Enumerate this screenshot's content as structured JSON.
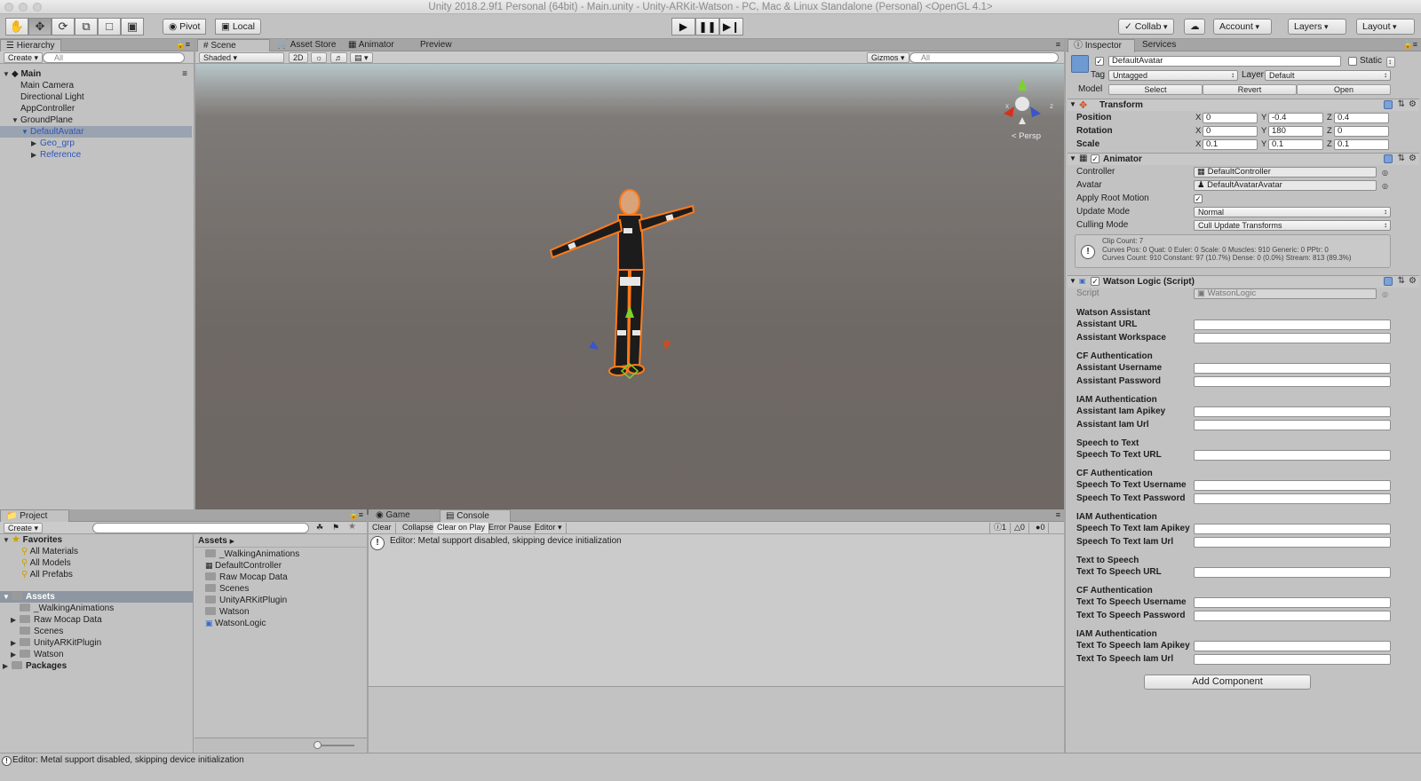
{
  "window": {
    "title": "Unity 2018.2.9f1 Personal (64bit) - Main.unity - Unity-ARKit-Watson - PC, Mac & Linux Standalone (Personal) <OpenGL 4.1>"
  },
  "toolbar": {
    "pivot": "Pivot",
    "local": "Local",
    "collab": "Collab",
    "account": "Account",
    "layers": "Layers",
    "layout": "Layout",
    "tools": [
      "hand-tool-icon",
      "move-tool-icon",
      "rotate-tool-icon",
      "scale-tool-icon",
      "rect-tool-icon",
      "transform-tool-icon"
    ]
  },
  "hierarchy": {
    "tab": "Hierarchy",
    "create": "Create",
    "search_placeholder": "All",
    "scene": "Main",
    "items": [
      {
        "label": "Main Camera"
      },
      {
        "label": "Directional Light"
      },
      {
        "label": "AppController"
      },
      {
        "label": "GroundPlane"
      },
      {
        "label": "DefaultAvatar"
      },
      {
        "label": "Geo_grp"
      },
      {
        "label": "Reference"
      }
    ]
  },
  "scene_view": {
    "tabs": [
      "Scene",
      "Asset Store",
      "Animator",
      "Preview"
    ],
    "shading": "Shaded",
    "mode_2d": "2D",
    "gizmos": "Gizmos",
    "search_placeholder": "All",
    "persp": "Persp",
    "gizmo_x": "x",
    "gizmo_z": "z"
  },
  "project": {
    "tab": "Project",
    "create": "Create",
    "favorites_label": "Favorites",
    "favorites": [
      "All Materials",
      "All Models",
      "All Prefabs"
    ],
    "assets_label": "Assets",
    "asset_tree": [
      "_WalkingAnimations",
      "Raw Mocap Data",
      "Scenes",
      "UnityARKitPlugin",
      "Watson"
    ],
    "packages_label": "Packages",
    "breadcrumb": "Assets",
    "asset_list": [
      "_WalkingAnimations",
      "DefaultController",
      "Raw Mocap Data",
      "Scenes",
      "UnityARKitPlugin",
      "Watson",
      "WatsonLogic"
    ]
  },
  "console": {
    "tabs": [
      "Game",
      "Console"
    ],
    "buttons": [
      "Clear",
      "Collapse",
      "Clear on Play",
      "Error Pause",
      "Editor"
    ],
    "counts": [
      "1",
      "0",
      "0"
    ],
    "message": "Editor: Metal support disabled, skipping device initialization"
  },
  "inspector": {
    "tabs": [
      "Inspector",
      "Services"
    ],
    "object_name": "DefaultAvatar",
    "static_label": "Static",
    "tag_label": "Tag",
    "tag_value": "Untagged",
    "layer_label": "Layer",
    "layer_value": "Default",
    "model_label": "Model",
    "model_buttons": [
      "Select",
      "Revert",
      "Open"
    ],
    "transform": {
      "title": "Transform",
      "rows": [
        {
          "label": "Position",
          "x": "0",
          "y": "-0.4",
          "z": "0.4"
        },
        {
          "label": "Rotation",
          "x": "0",
          "y": "180",
          "z": "0"
        },
        {
          "label": "Scale",
          "x": "0.1",
          "y": "0.1",
          "z": "0.1"
        }
      ]
    },
    "animator": {
      "title": "Animator",
      "controller_label": "Controller",
      "controller_value": "DefaultController",
      "avatar_label": "Avatar",
      "avatar_value": "DefaultAvatarAvatar",
      "root_motion_label": "Apply Root Motion",
      "update_mode_label": "Update Mode",
      "update_mode_value": "Normal",
      "culling_mode_label": "Culling Mode",
      "culling_mode_value": "Cull Update Transforms",
      "info": [
        "Clip Count: 7",
        "Curves Pos: 0 Quat: 0 Euler: 0 Scale: 0 Muscles: 910 Generic: 0 PPtr: 0",
        "Curves Count: 910 Constant: 97 (10.7%) Dense: 0 (0.0%) Stream: 813 (89.3%)"
      ]
    },
    "watson": {
      "title": "Watson Logic (Script)",
      "script_label": "Script",
      "script_value": "WatsonLogic",
      "rows": [
        {
          "type": "header",
          "label": "Watson Assistant"
        },
        {
          "type": "field",
          "label": "Assistant URL"
        },
        {
          "type": "field",
          "label": "Assistant Workspace"
        },
        {
          "type": "header",
          "label": "CF Authentication"
        },
        {
          "type": "field",
          "label": "Assistant Username"
        },
        {
          "type": "field",
          "label": "Assistant Password"
        },
        {
          "type": "header",
          "label": "IAM Authentication"
        },
        {
          "type": "field",
          "label": "Assistant Iam Apikey"
        },
        {
          "type": "field",
          "label": "Assistant Iam Url"
        },
        {
          "type": "header",
          "label": "Speech to Text"
        },
        {
          "type": "field",
          "label": "Speech To Text URL"
        },
        {
          "type": "header",
          "label": "CF Authentication"
        },
        {
          "type": "field",
          "label": "Speech To Text Username"
        },
        {
          "type": "field",
          "label": "Speech To Text Password"
        },
        {
          "type": "header",
          "label": "IAM Authentication"
        },
        {
          "type": "field",
          "label": "Speech To Text Iam Apikey"
        },
        {
          "type": "field",
          "label": "Speech To Text Iam Url"
        },
        {
          "type": "header",
          "label": "Text to Speech"
        },
        {
          "type": "field",
          "label": "Text To Speech URL"
        },
        {
          "type": "header",
          "label": "CF Authentication"
        },
        {
          "type": "field",
          "label": "Text To Speech Username"
        },
        {
          "type": "field",
          "label": "Text To Speech Password"
        },
        {
          "type": "header",
          "label": "IAM Authentication"
        },
        {
          "type": "field",
          "label": "Text To Speech Iam Apikey"
        },
        {
          "type": "field",
          "label": "Text To Speech Iam Url"
        }
      ]
    },
    "add_component": "Add Component"
  },
  "statusbar": {
    "message": "Editor: Metal support disabled, skipping device initialization"
  }
}
